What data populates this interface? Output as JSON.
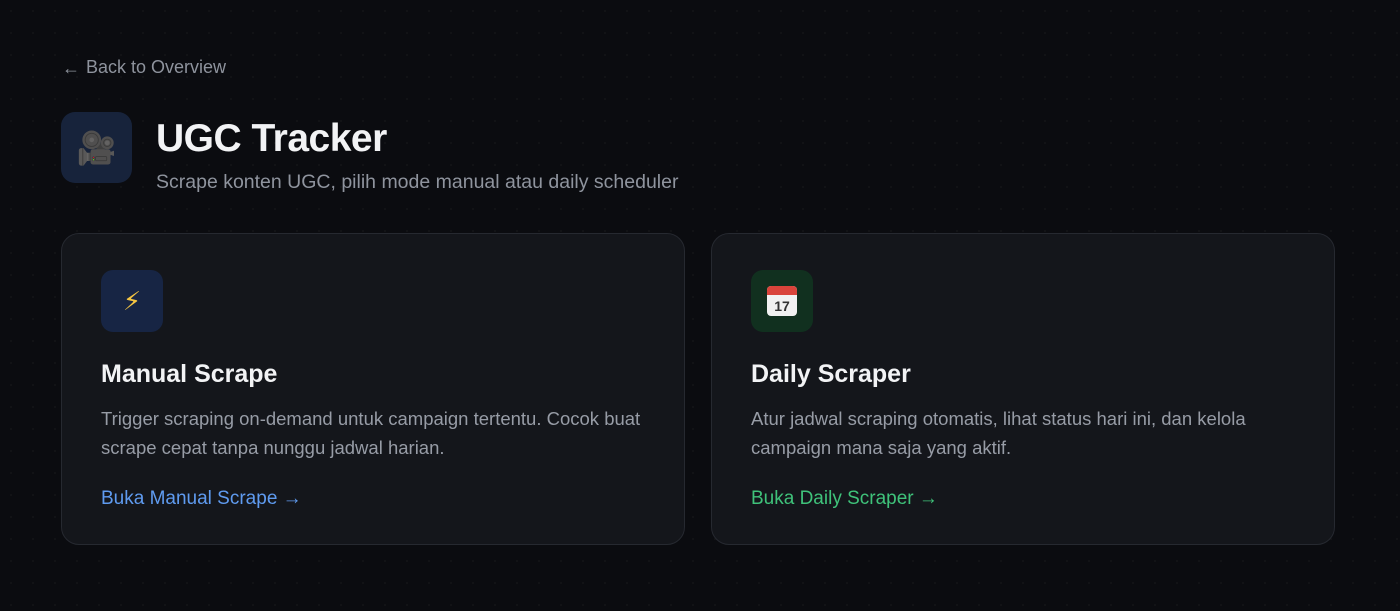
{
  "nav": {
    "back_arrow": "←",
    "back_label": "Back to Overview"
  },
  "header": {
    "icon": "🎥",
    "icon_name": "movie-camera-icon",
    "title": "UGC Tracker",
    "subtitle": "Scrape konten UGC, pilih mode manual atau daily scheduler"
  },
  "cards": [
    {
      "icon": "⚡",
      "icon_name": "lightning-icon",
      "title": "Manual Scrape",
      "description": "Trigger scraping on-demand untuk campaign tertentu. Cocok buat scrape cepat tanpa nunggu jadwal harian.",
      "link_label": "Buka Manual Scrape →",
      "accent": "#5f9bf0"
    },
    {
      "icon_name": "calendar-icon",
      "calendar_day": "17",
      "title": "Daily Scraper",
      "description": "Atur jadwal scraping otomatis, lihat status hari ini, dan kelola campaign mana saja yang aktif.",
      "link_label": "Buka Daily Scraper →",
      "accent": "#3fc27a"
    }
  ],
  "colors": {
    "background": "#0b0c10",
    "card_background": "#14161b",
    "card_border": "#262930",
    "blue_accent": "#5f9bf0",
    "green_accent": "#3fc27a"
  }
}
